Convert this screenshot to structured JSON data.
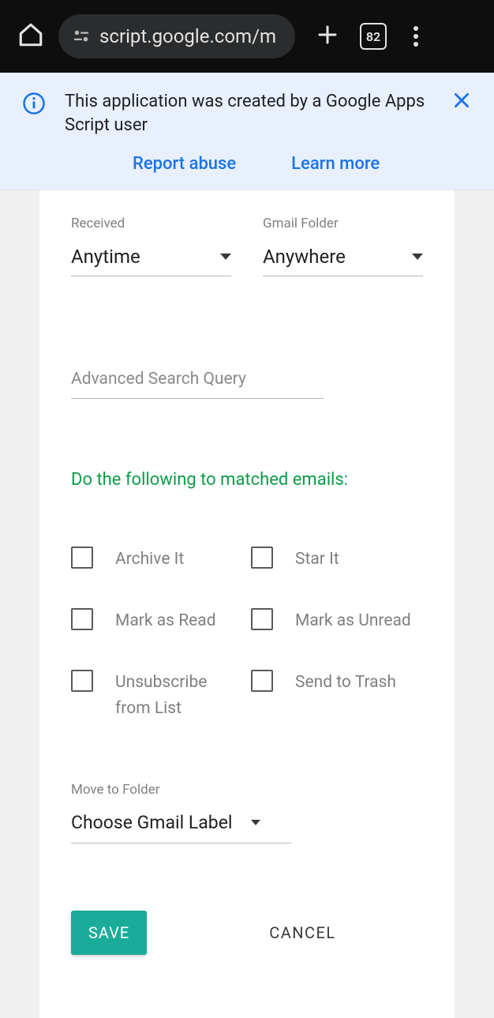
{
  "browser": {
    "url": "script.google.com/m",
    "tab_count": "82"
  },
  "banner": {
    "message": "This application was created by a Google Apps Script user",
    "report_link": "Report abuse",
    "learn_link": "Learn more"
  },
  "form": {
    "received": {
      "label": "Received",
      "value": "Anytime"
    },
    "gmail_folder": {
      "label": "Gmail Folder",
      "value": "Anywhere"
    },
    "search": {
      "placeholder": "Advanced Search Query"
    },
    "section_title": "Do the following to matched emails:",
    "checkboxes": {
      "archive": "Archive It",
      "star": "Star It",
      "mark_read": "Mark as Read",
      "mark_unread": "Mark as Unread",
      "unsubscribe": "Unsubscribe from List",
      "trash": "Send to Trash"
    },
    "move": {
      "label": "Move to Folder",
      "value": "Choose Gmail Label"
    },
    "buttons": {
      "save": "SAVE",
      "cancel": "CANCEL"
    }
  }
}
